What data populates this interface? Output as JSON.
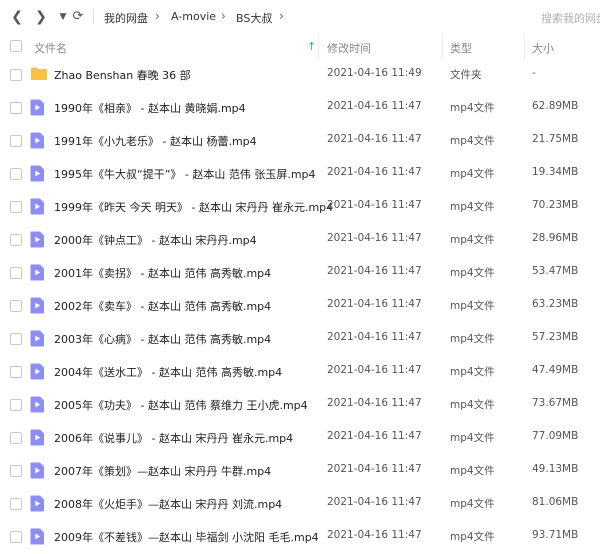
{
  "toolbar": {
    "breadcrumb": [
      "我的网盘",
      "A-movie",
      "BS大叔"
    ],
    "search_placeholder": "搜索我的网盘"
  },
  "columns": {
    "name": "文件名",
    "modified": "修改时间",
    "type": "类型",
    "size": "大小"
  },
  "files": [
    {
      "name": "Zhao Benshan 春晚 36 部",
      "date": "2021-04-16 11:49",
      "type": "文件夹",
      "size": "-",
      "icon": "folder-icon"
    },
    {
      "name": "1990年《相亲》 - 赵本山 黄晓娟.mp4",
      "date": "2021-04-16 11:47",
      "type": "mp4文件",
      "size": "62.89MB",
      "icon": "video-file-icon"
    },
    {
      "name": "1991年《小九老乐》 - 赵本山 杨蕾.mp4",
      "date": "2021-04-16 11:47",
      "type": "mp4文件",
      "size": "21.75MB",
      "icon": "video-file-icon"
    },
    {
      "name": "1995年《牛大叔“提干”》 - 赵本山 范伟 张玉屏.mp4",
      "date": "2021-04-16 11:47",
      "type": "mp4文件",
      "size": "19.34MB",
      "icon": "video-file-icon"
    },
    {
      "name": "1999年《昨天 今天 明天》 - 赵本山 宋丹丹 崔永元.mp4",
      "date": "2021-04-16 11:47",
      "type": "mp4文件",
      "size": "70.23MB",
      "icon": "video-file-icon"
    },
    {
      "name": "2000年《钟点工》 - 赵本山 宋丹丹.mp4",
      "date": "2021-04-16 11:47",
      "type": "mp4文件",
      "size": "28.96MB",
      "icon": "video-file-icon"
    },
    {
      "name": "2001年《卖拐》 - 赵本山 范伟 高秀敏.mp4",
      "date": "2021-04-16 11:47",
      "type": "mp4文件",
      "size": "53.47MB",
      "icon": "video-file-icon"
    },
    {
      "name": "2002年《卖车》 - 赵本山 范伟 高秀敏.mp4",
      "date": "2021-04-16 11:47",
      "type": "mp4文件",
      "size": "63.23MB",
      "icon": "video-file-icon"
    },
    {
      "name": "2003年《心病》 - 赵本山 范伟 高秀敏.mp4",
      "date": "2021-04-16 11:47",
      "type": "mp4文件",
      "size": "57.23MB",
      "icon": "video-file-icon"
    },
    {
      "name": "2004年《送水工》 - 赵本山 范伟 高秀敏.mp4",
      "date": "2021-04-16 11:47",
      "type": "mp4文件",
      "size": "47.49MB",
      "icon": "video-file-icon"
    },
    {
      "name": "2005年《功夫》 - 赵本山 范伟 蔡维力 王小虎.mp4",
      "date": "2021-04-16 11:47",
      "type": "mp4文件",
      "size": "73.67MB",
      "icon": "video-file-icon"
    },
    {
      "name": "2006年《说事儿》 - 赵本山 宋丹丹 崔永元.mp4",
      "date": "2021-04-16 11:47",
      "type": "mp4文件",
      "size": "77.09MB",
      "icon": "video-file-icon"
    },
    {
      "name": "2007年《策划》—赵本山 宋丹丹 牛群.mp4",
      "date": "2021-04-16 11:47",
      "type": "mp4文件",
      "size": "49.13MB",
      "icon": "video-file-icon"
    },
    {
      "name": "2008年《火炬手》—赵本山 宋丹丹 刘流.mp4",
      "date": "2021-04-16 11:47",
      "type": "mp4文件",
      "size": "81.06MB",
      "icon": "video-file-icon"
    },
    {
      "name": "2009年《不差钱》—赵本山 毕福剑 小沈阳 毛毛.mp4",
      "date": "2021-04-16 11:47",
      "type": "mp4文件",
      "size": "93.71MB",
      "icon": "video-file-icon"
    }
  ],
  "colors": {
    "folder": "#f7c244",
    "video_icon": "#8c8df5",
    "sort_arrow": "#4a8ef0"
  }
}
